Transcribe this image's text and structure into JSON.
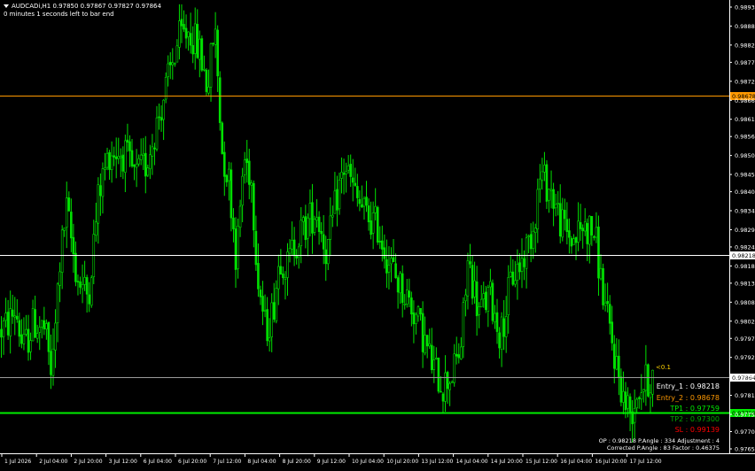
{
  "header": {
    "symbol_line": "AUDCADi,H1  0.97850 0.97867 0.97827 0.97864",
    "timer": "0 minutes 1 seconds left to bar end"
  },
  "colors": {
    "background": "#000000",
    "candle": "#00e000",
    "orange_line": "#ff9900",
    "white_line": "#ffffff",
    "green_line": "#00ee00",
    "gray_line": "#9a9a9a",
    "entry1": "#ffffff",
    "entry2": "#ff9900",
    "tp1": "#00ee00",
    "tp2": "#00aa00",
    "sl": "#ff0000",
    "note": "#ffd400"
  },
  "info": {
    "entry1": "Entry_1 : 0.98218",
    "entry2": "Entry_2 : 0.98678",
    "tp1": "TP1 : 0.97759",
    "tp2": "TP2 : 0.97300",
    "sl": "SL : 0.99139",
    "footer1": "OP : 0.98218   P.Angle : 334   Adjustment : 4",
    "footer2": "Corrected P.Angle : 83   Factor : 0.46375",
    "angle_note": "<0.1"
  },
  "chart_data": {
    "type": "candlestick",
    "symbol": "AUDCADi",
    "timeframe": "H1",
    "ylim": [
      0.97655,
      0.98935
    ],
    "y_ticks": [
      "0.98935",
      "0.98880",
      "0.98825",
      "0.98775",
      "0.98720",
      "0.98665",
      "0.98610",
      "0.98560",
      "0.98505",
      "0.98450",
      "0.98400",
      "0.98345",
      "0.98290",
      "0.98240",
      "0.98185",
      "0.98135",
      "0.98080",
      "0.98025",
      "0.97975",
      "0.97920",
      "0.97865",
      "0.97810",
      "0.97755",
      "0.97705",
      "0.97655"
    ],
    "y_tick_values": [
      0.98935,
      0.9888,
      0.98825,
      0.98775,
      0.9872,
      0.98665,
      0.9861,
      0.9856,
      0.98505,
      0.9845,
      0.984,
      0.98345,
      0.9829,
      0.9824,
      0.98185,
      0.98135,
      0.9808,
      0.98025,
      0.97975,
      0.9792,
      0.97865,
      0.9781,
      0.97755,
      0.97705,
      0.97655
    ],
    "x_ticks": [
      "1 Jul 2026",
      "2 Jul 04:00",
      "2 Jul 20:00",
      "3 Jul 12:00",
      "6 Jul 04:00",
      "6 Jul 20:00",
      "7 Jul 12:00",
      "8 Jul 04:00",
      "8 Jul 20:00",
      "9 Jul 12:00",
      "10 Jul 04:00",
      "10 Jul 20:00",
      "13 Jul 12:00",
      "14 Jul 04:00",
      "14 Jul 20:00",
      "15 Jul 12:00",
      "16 Jul 04:00",
      "16 Jul 20:00",
      "17 Jul 12:00"
    ],
    "current_price": 0.97864,
    "current_price_label": "0.97864",
    "levels": [
      {
        "name": "entry2",
        "value": 0.98678,
        "label": "0.98678",
        "color": "#ff9900"
      },
      {
        "name": "entry1",
        "value": 0.98218,
        "label": "0.98218",
        "color": "#ffffff"
      },
      {
        "name": "tp1",
        "value": 0.97759,
        "label": "0.97759",
        "color": "#00ee00"
      }
    ],
    "path_anchors": [
      [
        0,
        0.98
      ],
      [
        0.01,
        0.9802
      ],
      [
        0.02,
        0.9806
      ],
      [
        0.03,
        0.9794
      ],
      [
        0.045,
        0.9802
      ],
      [
        0.06,
        0.98
      ],
      [
        0.07,
        0.9786
      ],
      [
        0.08,
        0.9818
      ],
      [
        0.09,
        0.9835
      ],
      [
        0.105,
        0.9815
      ],
      [
        0.12,
        0.981
      ],
      [
        0.135,
        0.984
      ],
      [
        0.15,
        0.9852
      ],
      [
        0.17,
        0.9851
      ],
      [
        0.185,
        0.9844
      ],
      [
        0.2,
        0.9848
      ],
      [
        0.215,
        0.986
      ],
      [
        0.23,
        0.9872
      ],
      [
        0.245,
        0.9884
      ],
      [
        0.26,
        0.9887
      ],
      [
        0.275,
        0.988
      ],
      [
        0.285,
        0.987
      ],
      [
        0.295,
        0.9888
      ],
      [
        0.305,
        0.9852
      ],
      [
        0.315,
        0.9843
      ],
      [
        0.325,
        0.982
      ],
      [
        0.335,
        0.985
      ],
      [
        0.345,
        0.9845
      ],
      [
        0.355,
        0.9815
      ],
      [
        0.365,
        0.98
      ],
      [
        0.375,
        0.9805
      ],
      [
        0.385,
        0.9822
      ],
      [
        0.395,
        0.9818
      ],
      [
        0.405,
        0.9825
      ],
      [
        0.42,
        0.983
      ],
      [
        0.435,
        0.9835
      ],
      [
        0.45,
        0.9822
      ],
      [
        0.465,
        0.984
      ],
      [
        0.475,
        0.9848
      ],
      [
        0.49,
        0.9838
      ],
      [
        0.505,
        0.9833
      ],
      [
        0.52,
        0.983
      ],
      [
        0.535,
        0.982
      ],
      [
        0.55,
        0.9813
      ],
      [
        0.565,
        0.9808
      ],
      [
        0.58,
        0.98
      ],
      [
        0.595,
        0.979
      ],
      [
        0.61,
        0.9784
      ],
      [
        0.625,
        0.9788
      ],
      [
        0.635,
        0.9795
      ],
      [
        0.645,
        0.982
      ],
      [
        0.66,
        0.9805
      ],
      [
        0.675,
        0.981
      ],
      [
        0.69,
        0.9798
      ],
      [
        0.705,
        0.9815
      ],
      [
        0.72,
        0.982
      ],
      [
        0.735,
        0.983
      ],
      [
        0.745,
        0.9845
      ],
      [
        0.76,
        0.984
      ],
      [
        0.775,
        0.983
      ],
      [
        0.79,
        0.9826
      ],
      [
        0.805,
        0.983
      ],
      [
        0.82,
        0.9828
      ],
      [
        0.83,
        0.9812
      ],
      [
        0.84,
        0.98
      ],
      [
        0.85,
        0.979
      ],
      [
        0.86,
        0.978
      ],
      [
        0.87,
        0.9776
      ],
      [
        0.88,
        0.9783
      ],
      [
        0.9,
        0.97864
      ]
    ],
    "candle_count": 290
  }
}
